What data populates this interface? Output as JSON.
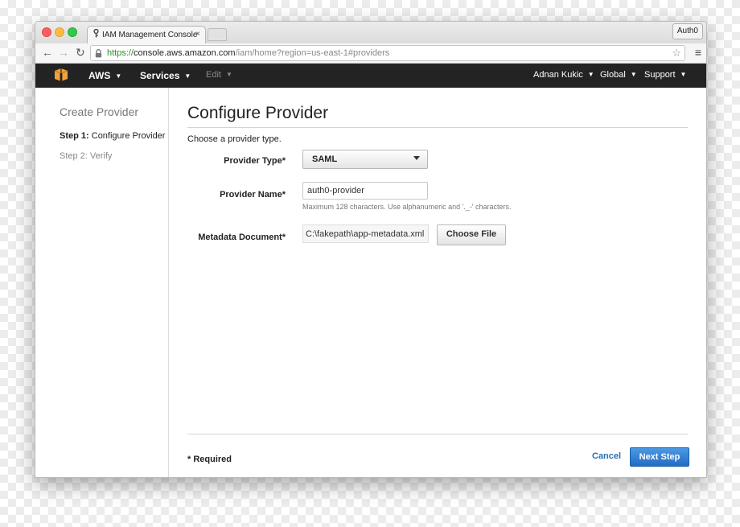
{
  "browser": {
    "tab_title": "IAM Management Console",
    "tab_close": "×",
    "extension_label": "Auth0",
    "url_scheme": "https://",
    "url_host": "console.aws.amazon.com",
    "url_path": "/iam/home?region=us-east-1#providers",
    "back": "←",
    "forward": "→",
    "reload": "↻",
    "lock": "🔒",
    "star": "☆",
    "menu": "≡"
  },
  "awsnav": {
    "aws_label": "AWS",
    "services_label": "Services",
    "edit_label": "Edit",
    "user_label": "Adnan Kukic",
    "region_label": "Global",
    "support_label": "Support",
    "caret": "▼",
    "logo_color": "#f0a13c"
  },
  "sidebar": {
    "title": "Create Provider",
    "step1_prefix": "Step 1:",
    "step1_label": "Configure Provider",
    "step2_label": "Step 2: Verify"
  },
  "main": {
    "title": "Configure Provider",
    "subtitle": "Choose a provider type.",
    "provider_type_label": "Provider Type*",
    "provider_type_value": "SAML",
    "provider_name_label": "Provider Name*",
    "provider_name_value": "auth0-provider",
    "provider_name_hint": "Maximum 128 characters. Use alphanumeric and '._-' characters.",
    "metadata_label": "Metadata Document*",
    "metadata_value": "C:\\fakepath\\app-metadata.xml",
    "choose_file_label": "Choose File",
    "required_note": "* Required",
    "cancel_label": "Cancel",
    "next_label": "Next Step"
  }
}
